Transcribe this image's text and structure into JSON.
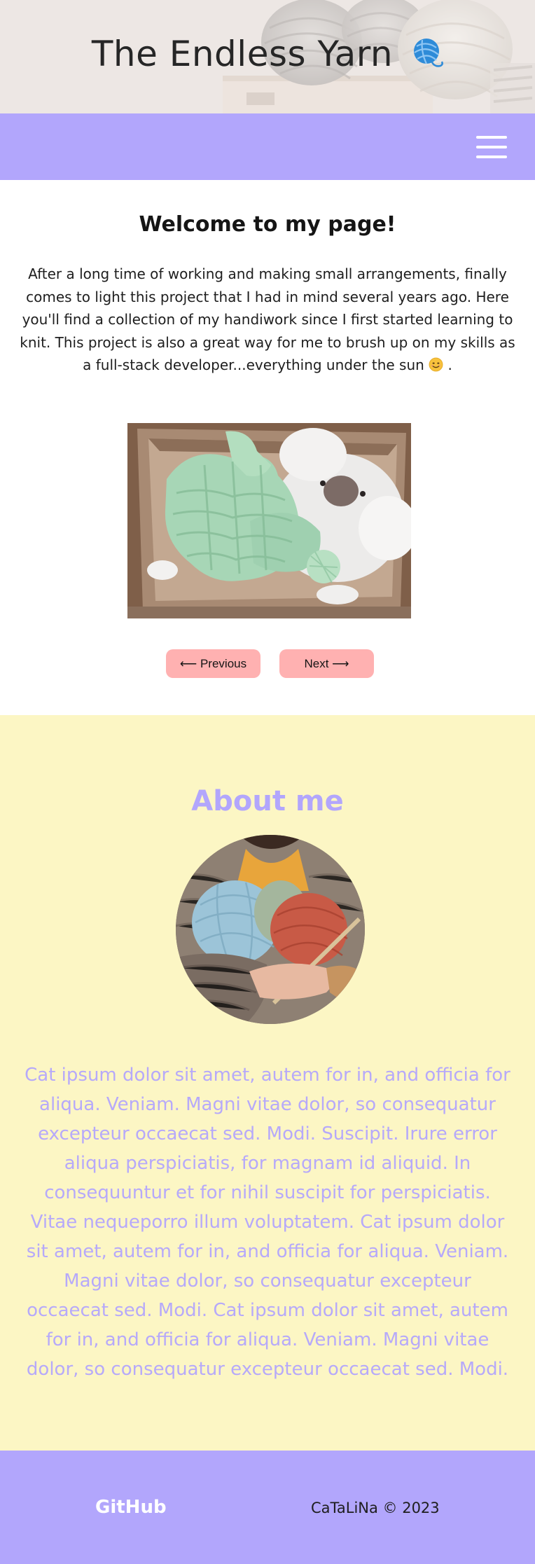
{
  "hero": {
    "title": "The Endless Yarn",
    "icon": "yarn-ball-icon",
    "background_image": "yarn-balls-photo"
  },
  "nav": {
    "menu_icon": "hamburger-menu-icon"
  },
  "welcome": {
    "heading": "Welcome to my page!",
    "paragraph": "After a long time of working and making small arrangements, finally comes to light this project that I had in mind several years ago. Here you'll find a collection of my handiwork since I first started learning to knit. This project is also a great way for me to brush up on my skills as a full-stack developer...everything under the sun",
    "paragraph_end": ".",
    "emoji": "smiling-face-emoji",
    "gallery_image": "knitted-baby-set-photo",
    "prev_label": "⟵ Previous",
    "next_label": "Next ⟶"
  },
  "about": {
    "heading": "About me",
    "avatar_image": "yarn-and-needles-photo",
    "text": "Cat ipsum dolor sit amet, autem for in, and officia for aliqua. Veniam. Magni vitae dolor, so consequatur excepteur occaecat sed. Modi. Suscipit. Irure error aliqua perspiciatis, for magnam id aliquid. In consequuntur et for nihil suscipit for perspiciatis. Vitae nequeporro illum voluptatem. Cat ipsum dolor sit amet, autem for in, and officia for aliqua. Veniam. Magni vitae dolor, so consequatur excepteur occaecat sed. Modi. Cat ipsum dolor sit amet, autem for in, and officia for aliqua. Veniam. Magni vitae dolor, so consequatur excepteur occaecat sed. Modi."
  },
  "footer": {
    "link_label": "GitHub",
    "copyright": "CaTaLiNa © 2023"
  },
  "colors": {
    "lavender": "#b2a6fc",
    "cream": "#fcf6c4",
    "pink_button": "#ffb1b1",
    "about_text": "#b6a9fa"
  }
}
